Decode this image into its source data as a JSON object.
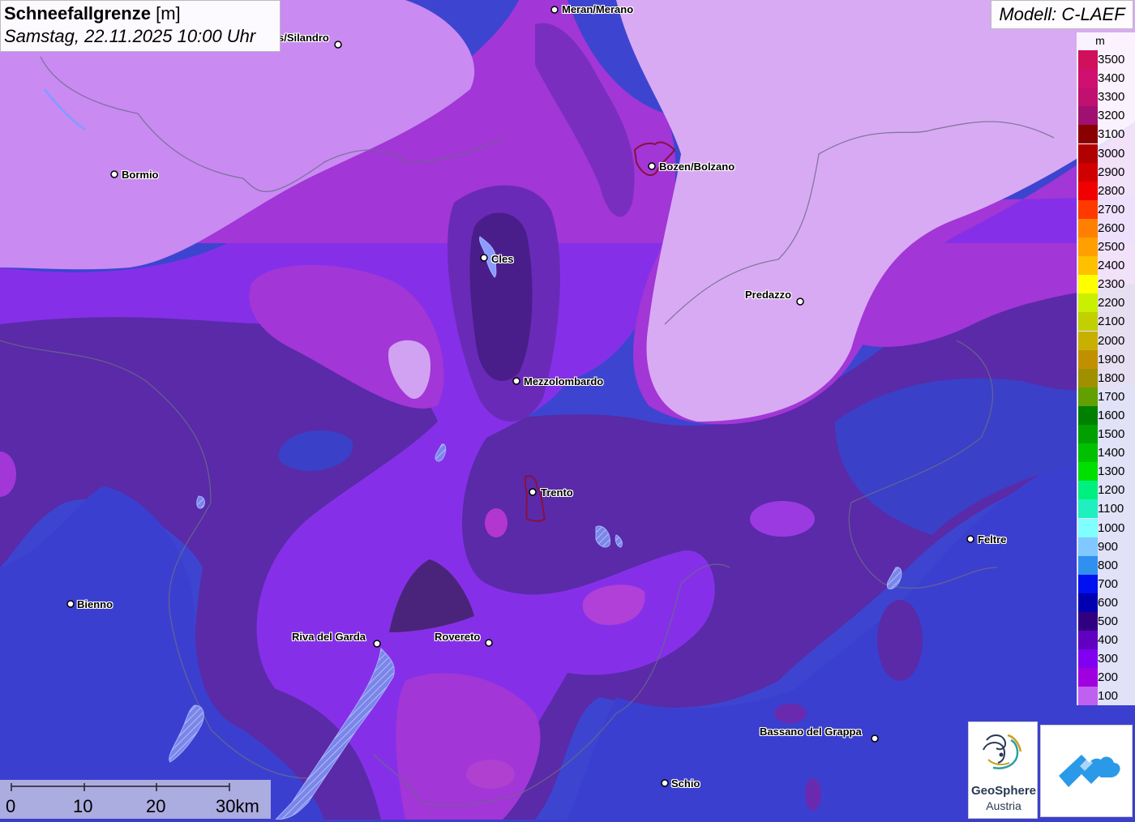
{
  "header": {
    "title_bold": "Schneefallgrenze",
    "title_unit": "[m]",
    "datetime": "Samstag, 22.11.2025 10:00 Uhr"
  },
  "model": {
    "label": "Modell: C-LAEF"
  },
  "legend": {
    "unit": "m",
    "entries": [
      {
        "label": "3500",
        "color": "#d0105a"
      },
      {
        "label": "3400",
        "color": "#d01070"
      },
      {
        "label": "3300",
        "color": "#c01070"
      },
      {
        "label": "3200",
        "color": "#a01070"
      },
      {
        "label": "3100",
        "color": "#8a0000"
      },
      {
        "label": "3000",
        "color": "#b00000"
      },
      {
        "label": "2900",
        "color": "#d00000"
      },
      {
        "label": "2800",
        "color": "#f00000"
      },
      {
        "label": "2700",
        "color": "#ff3a00"
      },
      {
        "label": "2600",
        "color": "#ff8000"
      },
      {
        "label": "2500",
        "color": "#ffa000"
      },
      {
        "label": "2400",
        "color": "#ffc000"
      },
      {
        "label": "2300",
        "color": "#ffff00"
      },
      {
        "label": "2200",
        "color": "#c8f000"
      },
      {
        "label": "2100",
        "color": "#c0d000"
      },
      {
        "label": "2000",
        "color": "#c8b000"
      },
      {
        "label": "1900",
        "color": "#c09000"
      },
      {
        "label": "1800",
        "color": "#a09000"
      },
      {
        "label": "1700",
        "color": "#60a000"
      },
      {
        "label": "1600",
        "color": "#008000"
      },
      {
        "label": "1500",
        "color": "#00a000"
      },
      {
        "label": "1400",
        "color": "#00c000"
      },
      {
        "label": "1300",
        "color": "#00e000"
      },
      {
        "label": "1200",
        "color": "#00f080"
      },
      {
        "label": "1100",
        "color": "#20f0c0"
      },
      {
        "label": "1000",
        "color": "#80ffff"
      },
      {
        "label": "900",
        "color": "#80c8ff"
      },
      {
        "label": "800",
        "color": "#3090f0"
      },
      {
        "label": "700",
        "color": "#0010f0"
      },
      {
        "label": "600",
        "color": "#0000b0"
      },
      {
        "label": "500",
        "color": "#300080"
      },
      {
        "label": "400",
        "color": "#6000c0"
      },
      {
        "label": "300",
        "color": "#8000f0"
      },
      {
        "label": "200",
        "color": "#a000e0"
      },
      {
        "label": "100",
        "color": "#c060f0"
      }
    ]
  },
  "scalebar": {
    "labels": [
      "0",
      "10",
      "20",
      "30km"
    ]
  },
  "cities": [
    {
      "name": "Meran/Merano"
    },
    {
      "name": "Schlanders/Silandro",
      "visible_text": "s/Silandro"
    },
    {
      "name": "Bormio"
    },
    {
      "name": "Bozen/Bolzano"
    },
    {
      "name": "Cles"
    },
    {
      "name": "Predazzo"
    },
    {
      "name": "Mezzolombardo"
    },
    {
      "name": "Trento"
    },
    {
      "name": "Feltre"
    },
    {
      "name": "Bienno"
    },
    {
      "name": "Riva del Garda"
    },
    {
      "name": "Rovereto"
    },
    {
      "name": "Bassano del Grappa"
    },
    {
      "name": "Schio"
    }
  ],
  "logos": {
    "geosphere_line1": "GeoSphere",
    "geosphere_line2": "Austria"
  }
}
